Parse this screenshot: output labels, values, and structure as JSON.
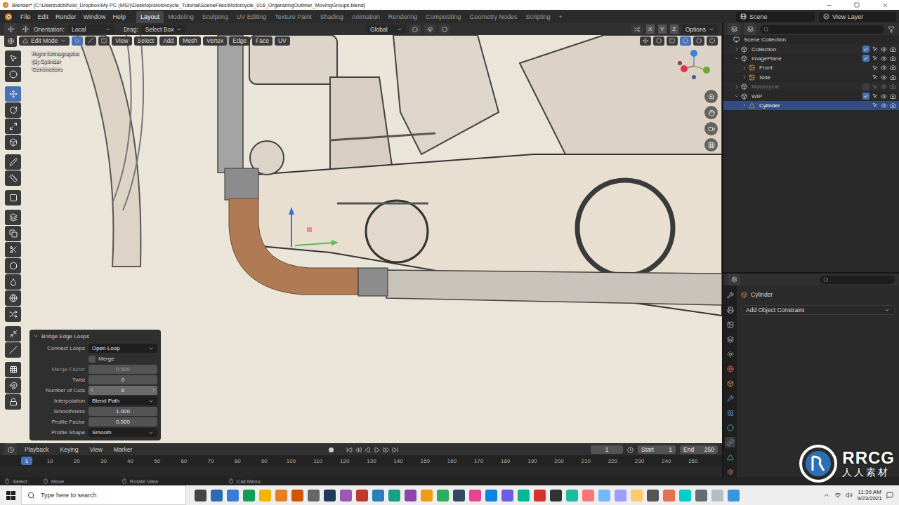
{
  "window": {
    "title": "Blender* [C:\\Users\\dcbit\\old_Dropbox\\My PC (MSI)\\Desktop\\Motorcycle_Tutorial\\SceneFiles\\Motorcycle_016_OrganizingOutliner_MovingGroups.blend]"
  },
  "menu": [
    "File",
    "Edit",
    "Render",
    "Window",
    "Help"
  ],
  "workspaces": [
    {
      "label": "Layout",
      "selected": true
    },
    {
      "label": "Modeling",
      "selected": false
    },
    {
      "label": "Sculpting",
      "selected": false
    },
    {
      "label": "UV Editing",
      "selected": false
    },
    {
      "label": "Texture Paint",
      "selected": false
    },
    {
      "label": "Shading",
      "selected": false
    },
    {
      "label": "Animation",
      "selected": false
    },
    {
      "label": "Rendering",
      "selected": false
    },
    {
      "label": "Compositing",
      "selected": false
    },
    {
      "label": "Geometry Nodes",
      "selected": false
    },
    {
      "label": "Scripting",
      "selected": false
    }
  ],
  "add_workspace": "+",
  "scene": {
    "scene": "Scene",
    "view_layer": "View Layer"
  },
  "tool_header": {
    "orientation_label": "Orientation:",
    "orientation": "Local",
    "drag_label": "Drag:",
    "drag": "Select Box",
    "transform": "Global",
    "axes": [
      "X",
      "Y",
      "Z"
    ],
    "options": "Options"
  },
  "editor_header": {
    "mode": "Edit Mode",
    "menus": [
      "View",
      "Select",
      "Add",
      "Mesh",
      "Vertex",
      "Edge",
      "Face",
      "UV"
    ]
  },
  "viewport": {
    "overlay": [
      "Right Orthographic",
      "(1) Cylinder",
      "Centimeters"
    ]
  },
  "tools": [
    {
      "selected": false
    },
    {
      "selected": false
    },
    {
      "selected": true
    },
    {
      "selected": false
    },
    {
      "selected": false
    },
    {
      "selected": false
    },
    {
      "selected": false
    },
    {
      "selected": false
    },
    {
      "selected": false
    },
    {
      "selected": false
    },
    {
      "selected": false
    },
    {
      "selected": false
    },
    {
      "selected": false
    },
    {
      "selected": false
    },
    {
      "selected": false
    },
    {
      "selected": false
    },
    {
      "selected": false
    },
    {
      "selected": false
    },
    {
      "selected": false
    },
    {
      "selected": false
    },
    {
      "selected": false
    }
  ],
  "operator_panel": {
    "title": "Bridge Edge Loops",
    "expanded": true,
    "fields": [
      {
        "kind": "dropdown",
        "label": "Connect Loops",
        "value": "Open Loop",
        "hovered": false,
        "disabled": false
      },
      {
        "kind": "checkbox",
        "label": "Merge",
        "checked": false,
        "hovered": false,
        "disabled": false
      },
      {
        "kind": "number",
        "label": "Merge Factor",
        "value": "0.500",
        "hovered": false,
        "disabled": true
      },
      {
        "kind": "number",
        "label": "Twist",
        "value": "0",
        "hovered": false,
        "disabled": false
      },
      {
        "kind": "number",
        "label": "Number of Cuts",
        "value": "6",
        "hovered": true,
        "disabled": false
      },
      {
        "kind": "dropdown",
        "label": "Interpolation",
        "value": "Blend Path",
        "hovered": false,
        "disabled": false
      },
      {
        "kind": "number",
        "label": "Smoothness",
        "value": "1.000",
        "hovered": false,
        "disabled": false
      },
      {
        "kind": "number",
        "label": "Profile Factor",
        "value": "0.000",
        "hovered": false,
        "disabled": false
      },
      {
        "kind": "dropdown",
        "label": "Profile Shape",
        "value": "Smooth",
        "hovered": false,
        "disabled": false
      }
    ]
  },
  "outliner": {
    "tree": [
      {
        "label": "Scene Collection",
        "kind": "scene",
        "expanded": true,
        "selected": false,
        "disabled": false,
        "children": [
          {
            "label": "Collection",
            "kind": "collection",
            "expanded": false,
            "checked": true,
            "selected": false,
            "disabled": false,
            "children": []
          },
          {
            "label": "ImagePlane",
            "kind": "collection",
            "expanded": true,
            "checked": true,
            "selected": false,
            "disabled": false,
            "children": [
              {
                "label": "Front",
                "kind": "image",
                "expanded": false,
                "selected": false,
                "disabled": false,
                "children": []
              },
              {
                "label": "Side",
                "kind": "image",
                "expanded": false,
                "selected": false,
                "disabled": false,
                "children": []
              }
            ]
          },
          {
            "label": "Motorcycle",
            "kind": "collection",
            "expanded": false,
            "checked": false,
            "selected": false,
            "disabled": true,
            "children": []
          },
          {
            "label": "WIP",
            "kind": "collection",
            "expanded": true,
            "checked": true,
            "selected": false,
            "disabled": false,
            "children": [
              {
                "label": "Cylinder",
                "kind": "mesh",
                "expanded": false,
                "selected": true,
                "disabled": false,
                "children": []
              }
            ]
          }
        ]
      }
    ]
  },
  "properties": {
    "object": "Cylinder",
    "constraint_button": "Add Object Constraint"
  },
  "timeline": {
    "menus": [
      "Playback",
      "Keying",
      "View",
      "Marker"
    ],
    "playhead": "1",
    "current_frame": "1",
    "start_label": "Start",
    "start": "1",
    "end_label": "End",
    "end": "250",
    "ticks": [
      "10",
      "20",
      "30",
      "40",
      "50",
      "60",
      "70",
      "80",
      "90",
      "100",
      "110",
      "120",
      "130",
      "140",
      "150",
      "160",
      "170",
      "180",
      "190",
      "200",
      "210",
      "220",
      "230",
      "240",
      "250"
    ]
  },
  "status_bar": [
    "Select",
    "Move",
    "Rotate View",
    "Call Menu"
  ],
  "taskbar": {
    "search_placeholder": "Type here to search",
    "time": "11:39 AM",
    "date": "9/23/2021"
  },
  "watermark": {
    "logo": "RRCG",
    "caption": "人人素材"
  }
}
